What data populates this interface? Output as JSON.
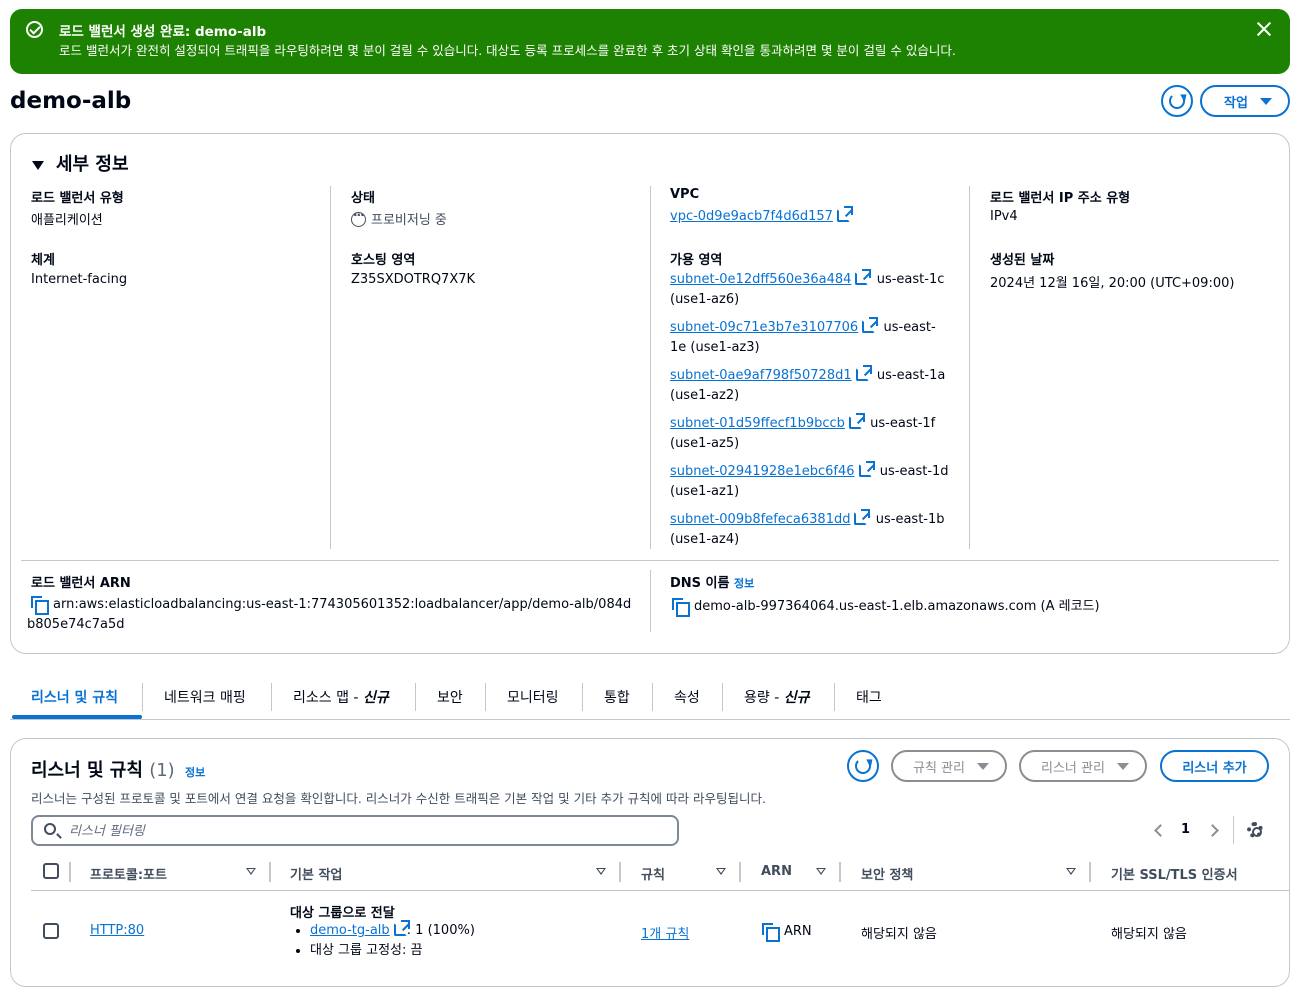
{
  "flash": {
    "title": "로드 밸런서 생성 완료: demo-alb",
    "message": "로드 밸런서가 완전히 설정되어 트래픽을 라우팅하려면 몇 분이 걸릴 수 있습니다. 대상도 등록 프로세스를 완료한 후 초기 상태 확인을 통과하려면 몇 분이 걸릴 수 있습니다.",
    "color": "#1d8102"
  },
  "page": {
    "title": "demo-alb",
    "actions_label": "작업"
  },
  "details": {
    "title": "세부 정보",
    "lb_type_label": "로드 밸런서 유형",
    "lb_type_value": "애플리케이션",
    "scheme_label": "체계",
    "scheme_value": "Internet-facing",
    "status_label": "상태",
    "status_value": "프로비저닝 중",
    "hosted_zone_label": "호스팅 영역",
    "hosted_zone_value": "Z35SXDOTRQ7X7K",
    "vpc_label": "VPC",
    "vpc_value": "vpc-0d9e9acb7f4d6d157",
    "az_label": "가용 영역",
    "subnets": [
      {
        "id": "subnet-0e12dff560e36a484",
        "zone": "us-east-1c",
        "zone_id": "(use1-az6)"
      },
      {
        "id": "subnet-09c71e3b7e3107706",
        "zone": "us-east-",
        "zone_id": "1e (use1-az3)"
      },
      {
        "id": "subnet-0ae9af798f50728d1",
        "zone": "us-east-1a",
        "zone_id": "(use1-az2)"
      },
      {
        "id": "subnet-01d59ffecf1b9bccb",
        "zone": "us-east-1f",
        "zone_id": "(use1-az5)"
      },
      {
        "id": "subnet-02941928e1ebc6f46",
        "zone": "us-east-1d",
        "zone_id": "(use1-az1)"
      },
      {
        "id": "subnet-009b8fefeca6381dd",
        "zone": "us-east-1b",
        "zone_id": "(use1-az4)"
      }
    ],
    "ip_type_label": "로드 밸런서 IP 주소 유형",
    "ip_type_value": "IPv4",
    "created_label": "생성된 날짜",
    "created_value": "2024년 12월 16일, 20:00 (UTC+09:00)",
    "arn_label": "로드 밸런서 ARN",
    "arn_line1": "arn:aws:elasticloadbalancing:us-east-1:774305601352:loadbalancer/app/demo-alb/084d",
    "arn_line2": "b805e74c7a5d",
    "dns_label": "DNS 이름",
    "dns_info": "정보",
    "dns_value": "demo-alb-997364064.us-east-1.elb.amazonaws.com (A 레코드)"
  },
  "tabs": [
    {
      "label": "리스너 및 규칙",
      "suffix": ""
    },
    {
      "label": "네트워크 매핑",
      "suffix": ""
    },
    {
      "label": "리소스 맵 - ",
      "suffix": "신규"
    },
    {
      "label": "보안",
      "suffix": ""
    },
    {
      "label": "모니터링",
      "suffix": ""
    },
    {
      "label": "통합",
      "suffix": ""
    },
    {
      "label": "속성",
      "suffix": ""
    },
    {
      "label": "용량 - ",
      "suffix": "신규"
    },
    {
      "label": "태그",
      "suffix": ""
    }
  ],
  "listeners": {
    "title": "리스너 및 규칙",
    "count": "(1)",
    "info": "정보",
    "description": "리스너는 구성된 프로토콜 및 포트에서 연결 요청을 확인합니다. 리스너가 수신한 트래픽은 기본 작업 및 기타 추가 규칙에 따라 라우팅됩니다.",
    "manage_rules": "규칙 관리",
    "manage_listeners": "리스너 관리",
    "add_listener": "리스너 추가",
    "filter_placeholder": "리스너 필터링",
    "page_number": "1",
    "columns": [
      "프로토콜:포트",
      "기본 작업",
      "규칙",
      "ARN",
      "보안 정책",
      "기본 SSL/TLS 인증서"
    ],
    "rows": [
      {
        "protocol_port": "HTTP:80",
        "action_title": "대상 그룹으로 전달",
        "target_group": "demo-tg-alb",
        "target_weight": ": 1 (100%)",
        "stickiness": "대상 그룹 고정성: 끔",
        "rules": "1개 규칙",
        "arn": "ARN",
        "security_policy": "해당되지 않음",
        "ssl_cert": "해당되지 않음"
      }
    ]
  }
}
